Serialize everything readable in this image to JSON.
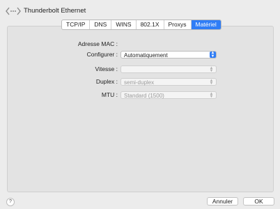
{
  "window": {
    "title": "Thunderbolt Ethernet",
    "icon": "network-dots-icon"
  },
  "tabs": [
    {
      "label": "TCP/IP",
      "active": false
    },
    {
      "label": "DNS",
      "active": false
    },
    {
      "label": "WINS",
      "active": false
    },
    {
      "label": "802.1X",
      "active": false
    },
    {
      "label": "Proxys",
      "active": false
    },
    {
      "label": "Matériel",
      "active": true
    }
  ],
  "form": {
    "mac_label": "Adresse MAC :",
    "mac_value": "",
    "configurer_label": "Configurer :",
    "configurer_value": "Automatiquement",
    "vitesse_label": "Vitesse :",
    "vitesse_value": "",
    "duplex_label": "Duplex :",
    "duplex_value": "semi-duplex",
    "mtu_label": "MTU :",
    "mtu_value": "Standard  (1500)"
  },
  "footer": {
    "help_label": "?",
    "cancel_label": "Annuler",
    "ok_label": "OK"
  },
  "colors": {
    "accent": "#2f7df6",
    "background": "#ececec"
  }
}
